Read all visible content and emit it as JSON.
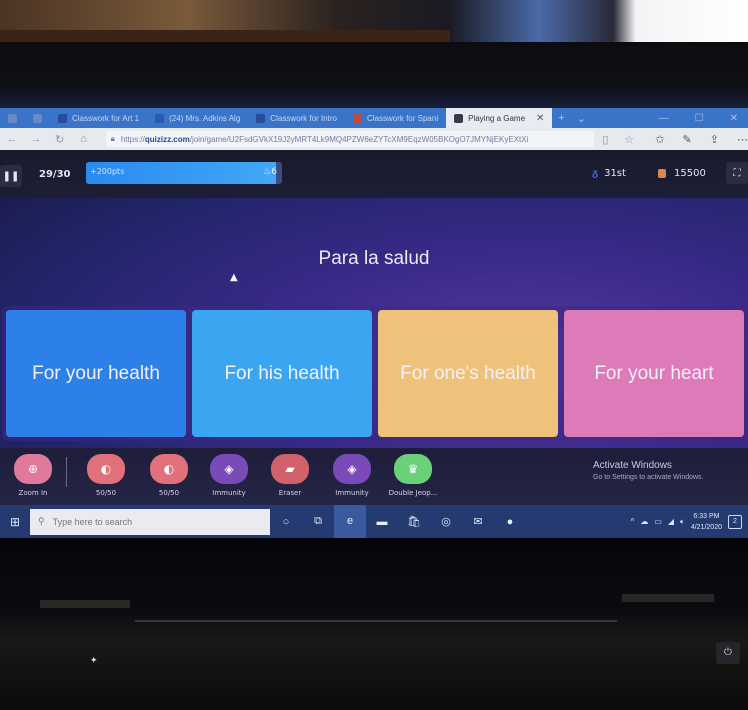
{
  "browser": {
    "tabs": [
      {
        "label": "",
        "icon": "window-icon",
        "color": "#6a8ac0"
      },
      {
        "label": "",
        "icon": "tabs-icon",
        "color": "#6a8ac0"
      },
      {
        "label": "Classwork for Art 1",
        "icon": "classroom-icon",
        "color": "#2a4a9a"
      },
      {
        "label": "(24) Mrs. Adkins Alg",
        "icon": "facebook-icon",
        "color": "#2a5ab0"
      },
      {
        "label": "Classwork for Intro",
        "icon": "classroom-icon",
        "color": "#2a4a9a"
      },
      {
        "label": "Classwork for Spani",
        "icon": "classroom-icon",
        "color": "#c04a3a"
      },
      {
        "label": "Playing a Game",
        "icon": "quizizz-icon",
        "color": "#3a3a4a",
        "active": true
      }
    ],
    "url_prefix": "https://",
    "url_domain": "quizizz.com",
    "url_path": "/join/game/U2FsdGVkX19J2yMRT4Lk9MQ4PZW6eZYTcXM9EqzW05BKOgO7JMYNjEKyEXtXi",
    "new_tab": "+",
    "tab_list": "⌄",
    "win_min": "—",
    "win_max": "☐",
    "win_close": "✕"
  },
  "game": {
    "question_counter": "29/30",
    "progress_fraction": 0.967,
    "points_label": "+200pts",
    "streak_label": "6",
    "rank": "31st",
    "score": "15500",
    "question": "Para la salud",
    "answers": [
      {
        "label": "For your health",
        "color": "#2d80e8"
      },
      {
        "label": "For his health",
        "color": "#3aa6f2"
      },
      {
        "label": "For one's health",
        "color": "#eec27a"
      },
      {
        "label": "For your heart",
        "color": "#dd7ab8"
      }
    ],
    "powerups": [
      {
        "label": "Zoom In",
        "icon": "zoom-in-icon",
        "glyph": "⊕",
        "color": "#e07a9a"
      },
      {
        "label": "50/50",
        "icon": "fifty-fifty-icon",
        "glyph": "◐",
        "color": "#e0707a"
      },
      {
        "label": "50/50",
        "icon": "fifty-fifty-icon",
        "glyph": "◐",
        "color": "#e0707a"
      },
      {
        "label": "Immunity",
        "icon": "shield-icon",
        "glyph": "◈",
        "color": "#7a4ab8"
      },
      {
        "label": "Eraser",
        "icon": "eraser-icon",
        "glyph": "▰",
        "color": "#d0606a"
      },
      {
        "label": "Immunity",
        "icon": "shield-icon",
        "glyph": "◈",
        "color": "#7a4ab8"
      },
      {
        "label": "Double Jeop...",
        "icon": "double-jeopardy-icon",
        "glyph": "♛",
        "color": "#6ad07a"
      }
    ],
    "activate_title": "Activate Windows",
    "activate_sub": "Go to Settings to activate Windows."
  },
  "taskbar": {
    "search_placeholder": "Type here to search",
    "time": "6:33 PM",
    "date": "4/21/2020",
    "notifications": "2"
  }
}
